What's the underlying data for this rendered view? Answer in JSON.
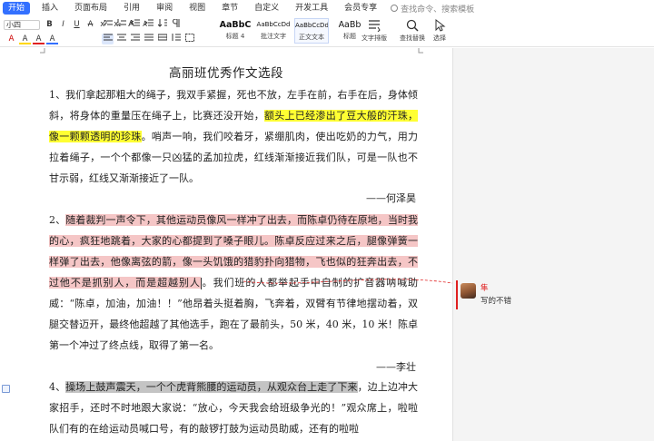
{
  "menubar": {
    "tabs": [
      "开始",
      "插入",
      "页面布局",
      "引用",
      "审阅",
      "视图",
      "章节",
      "自定义",
      "开发工具",
      "会员专享"
    ],
    "search_label": "查找命令、搜索模板"
  },
  "toolbar": {
    "font_size": "小四",
    "row1": [
      "B",
      "I",
      "U",
      "A",
      "x²",
      "x₂",
      "A",
      "A"
    ],
    "row2": [
      "A",
      "A",
      "A",
      "A"
    ],
    "styles": [
      {
        "preview": "AaBbC",
        "name": "标题 4"
      },
      {
        "preview": "AaBbCcDd",
        "name": "批注文字"
      },
      {
        "preview": "AaBbCcDd",
        "name": "正文文本"
      },
      {
        "preview": "AaBb",
        "name": "标题"
      }
    ],
    "text_layout_label": "文字排版",
    "find_replace_label": "查找替换",
    "select_label": "选择"
  },
  "document": {
    "title": "高丽班优秀作文选段",
    "p1_a": "1、我们拿起那粗大的绳子，我双手紧握，死也不放，左手在前，右手在后，身体倾斜，将身体的重量压在绳子上，比赛还没开始，",
    "p1_hl": "额头上已经渗出了豆大般的汗珠，像一颗颗透明的珍珠",
    "p1_b": "。哨声一响，我们咬着牙，紧绷肌肉，使出吃奶的力气，用力拉着绳子，一个个都像一只凶猛的孟加拉虎，红线渐渐接近我们队，可是一队也不甘示弱，红线又渐渐接近了一队。",
    "a1": "——何泽昊",
    "p2_a": "2、",
    "p2_hl": "随着裁判一声令下，其他运动员像风一样冲了出去，而陈卓仍待在原地，当时我的心，疯狂地跳着，大家的心都提到了嗓子眼儿。陈卓反应过来之后，腿像弹簧一样弹了出去，他像离弦的箭，像一头饥饿的猎豹扑向猎物，飞也似的狂奔出去，不过他不是抓别人，而是超越别人",
    "p2_b": "。我们班的人都举起手中自制的扩音器呐喊助威：“陈卓，加油，加油！！”他昂着头挺着胸，飞奔着，双臂有节律地摆动着，双腿交替迈开，最终他超越了其他选手，跑在了最前头，50 米，40 米，10 米！陈卓第一个冲过了终点线，取得了第一名。",
    "a2": "——李壮",
    "p3_a": "4、",
    "p3_hl": "操场上鼓声震天，一个个虎背熊腰的运动员，从观众台上走了下来",
    "p3_b": "，边上边冲大家招手，还时不时地跟大家说：“放心，今天我会给班级争光的！”观众席上，啦啦队们有的在给运动员喊口号，有的敲锣打鼓为运动员助威，还有的啦啦"
  },
  "comment": {
    "user": "隼",
    "text": "写的不错"
  },
  "colors": {
    "accent": "#3370ff",
    "highlight_yellow": "#ffff33",
    "highlight_pink": "#f5c6c6",
    "highlight_gray": "#c4c4c4",
    "comment_red": "#e02020"
  }
}
